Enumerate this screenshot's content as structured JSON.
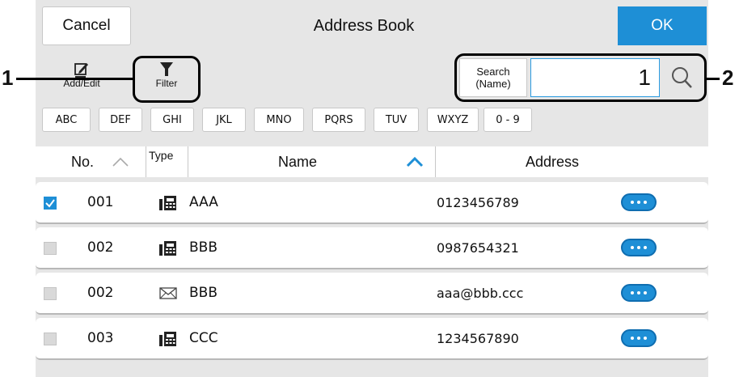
{
  "header": {
    "cancel_label": "Cancel",
    "title": "Address Book",
    "ok_label": "OK"
  },
  "toolbar": {
    "add_edit_label": "Add/Edit",
    "filter_label": "Filter"
  },
  "search": {
    "label": "Search\n(Name)",
    "value": "1"
  },
  "callouts": {
    "left": "1",
    "right": "2"
  },
  "letter_tabs": [
    "ABC",
    "DEF",
    "GHI",
    "JKL",
    "MNO",
    "PQRS",
    "TUV",
    "WXYZ",
    "0 - 9"
  ],
  "table": {
    "columns": {
      "no": "No.",
      "type": "Type",
      "name": "Name",
      "address": "Address"
    },
    "sort": {
      "no": "inactive",
      "name": "ascending-active"
    },
    "rows": [
      {
        "checked": true,
        "no": "001",
        "type": "fax-icon",
        "name": "AAA",
        "address": "0123456789"
      },
      {
        "checked": false,
        "no": "002",
        "type": "fax-icon",
        "name": "BBB",
        "address": "0987654321"
      },
      {
        "checked": false,
        "no": "002",
        "type": "email-icon",
        "name": "BBB",
        "address": "aaa@bbb.ccc"
      },
      {
        "checked": false,
        "no": "003",
        "type": "fax-icon",
        "name": "CCC",
        "address": "1234567890"
      }
    ]
  },
  "colors": {
    "accent": "#1e8fd6",
    "panel": "#e6e6e6",
    "callout": "#000000"
  }
}
